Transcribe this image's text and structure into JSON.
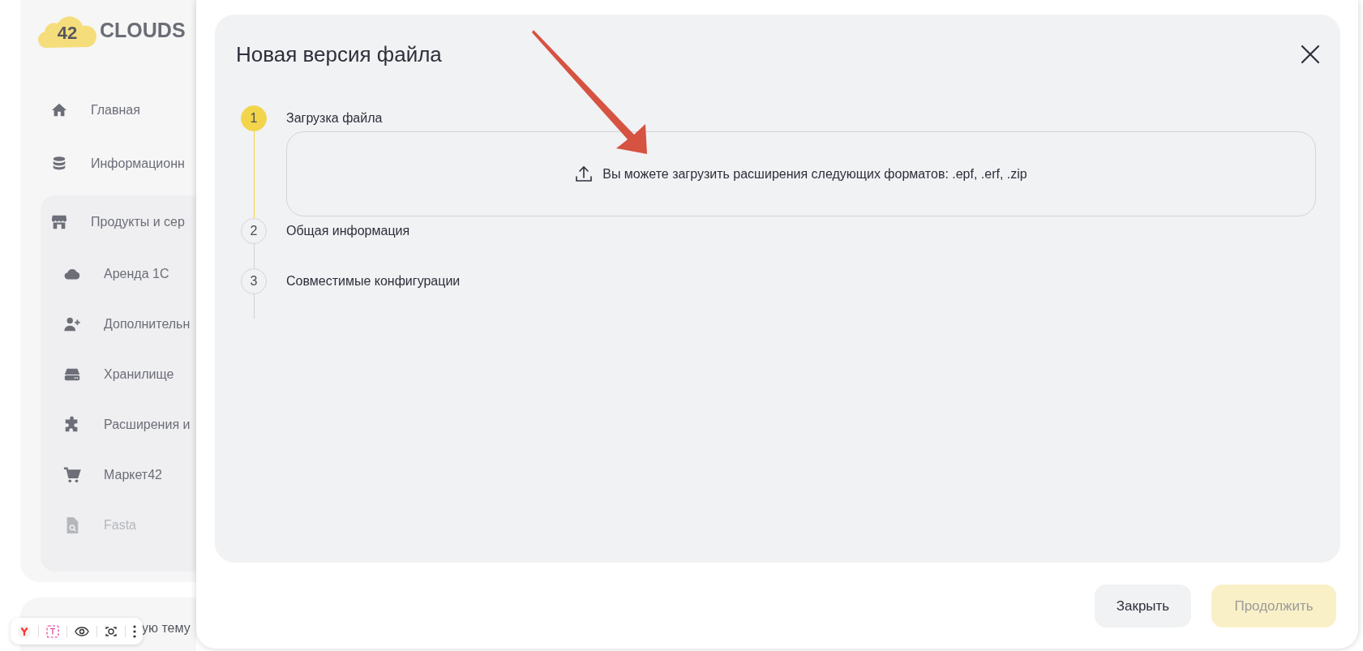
{
  "logo": {
    "badge": "42",
    "name": "CLOUDS"
  },
  "sidebar": {
    "items": [
      {
        "kind": "home",
        "label": "Главная",
        "disabled": false
      },
      {
        "kind": "database",
        "label": "Информационн",
        "disabled": false
      },
      {
        "kind": "store",
        "label": "Продукты и сер",
        "disabled": false,
        "expanded": true,
        "children": [
          {
            "kind": "cloud",
            "label": "Аренда 1С",
            "disabled": false
          },
          {
            "kind": "user-plus",
            "label": "Дополнительн",
            "disabled": false
          },
          {
            "kind": "drive",
            "label": "Хранилище",
            "disabled": false
          },
          {
            "kind": "puzzle",
            "label": "Расширения и",
            "disabled": false
          },
          {
            "kind": "cart",
            "label": "Маркет42",
            "disabled": false
          },
          {
            "kind": "file",
            "label": "Fasta",
            "disabled": true
          }
        ]
      }
    ]
  },
  "bottom_card": {
    "text": "ую тему"
  },
  "dialog": {
    "title": "Новая версия файла",
    "steps": [
      {
        "number": "1",
        "label": "Загрузка файла",
        "selected": true,
        "upload_hint": "Вы можете загрузить расширения следующих форматов: .epf, .erf, .zip"
      },
      {
        "number": "2",
        "label": "Общая информация",
        "selected": false
      },
      {
        "number": "3",
        "label": "Совместимые конфигурации",
        "selected": false
      }
    ],
    "buttons": [
      {
        "label": "Закрыть",
        "disabled": false
      },
      {
        "label": "Продолжить",
        "disabled": true
      }
    ]
  }
}
